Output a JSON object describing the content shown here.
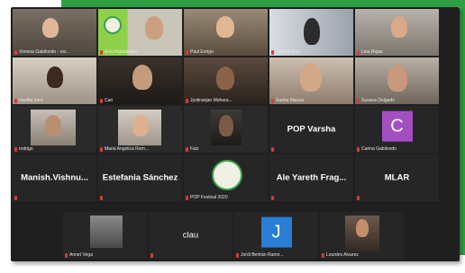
{
  "participants": [
    {
      "name": "Ximena Gabilondo - zw...",
      "avatar_letter": ""
    },
    {
      "name": "Ana Hanhausen",
      "avatar_letter": ""
    },
    {
      "name": "Paul Enrigo",
      "avatar_letter": ""
    },
    {
      "name": "Yara Beltran",
      "avatar_letter": ""
    },
    {
      "name": "Lina Rojas",
      "avatar_letter": ""
    },
    {
      "name": "medha hora",
      "avatar_letter": ""
    },
    {
      "name": "Cari",
      "avatar_letter": ""
    },
    {
      "name": "Jyotiranjan Mohara...",
      "avatar_letter": ""
    },
    {
      "name": "Sasha Macias",
      "avatar_letter": ""
    },
    {
      "name": "Susana Delgado",
      "avatar_letter": ""
    },
    {
      "name": "rodrigo",
      "avatar_letter": ""
    },
    {
      "name": "Maria Angelica Ram...",
      "avatar_letter": ""
    },
    {
      "name": "Faiz",
      "avatar_letter": ""
    },
    {
      "name": "POP Varsha",
      "avatar_letter": ""
    },
    {
      "name": "Carina Gabilondo",
      "avatar_letter": "C"
    },
    {
      "name": "Manish.Vishnu...",
      "avatar_letter": ""
    },
    {
      "name": "Estefania Sánchez",
      "avatar_letter": ""
    },
    {
      "name": "POP Festival 2020",
      "avatar_letter": ""
    },
    {
      "name": "Ale Yareth Frag...",
      "avatar_letter": ""
    },
    {
      "name": "MLAR",
      "avatar_letter": ""
    },
    {
      "name": "Annet Vega",
      "avatar_letter": ""
    },
    {
      "name": "clau",
      "avatar_letter": ""
    },
    {
      "name": "Jordi Bertrán Ramir...",
      "avatar_letter": "J"
    },
    {
      "name": "Lourdes Alvarez",
      "avatar_letter": ""
    }
  ],
  "colors": {
    "frame_accent": "#2f9e44",
    "muted_mic": "#d63b3b",
    "carina_avatar": "#a34fc2",
    "jordi_avatar": "#2a7ed6"
  },
  "icons": [
    "muted-mic-icon"
  ]
}
